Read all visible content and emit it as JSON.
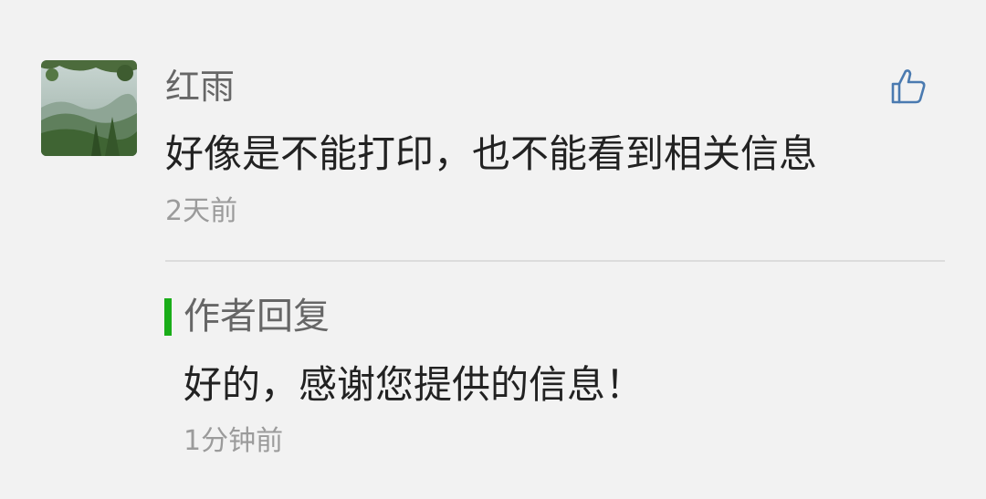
{
  "comment": {
    "author": "红雨",
    "avatar_icon": "landscape-avatar",
    "like_icon": "thumbs-up-icon",
    "text": "好像是不能打印，也不能看到相关信息",
    "time": "2天前"
  },
  "reply": {
    "label": "作者回复",
    "text": "好的，感谢您提供的信息！",
    "time": "1分钟前",
    "accent_color": "#1aad19"
  },
  "colors": {
    "background": "#f2f2f2",
    "like_icon": "#4a7ab0"
  }
}
